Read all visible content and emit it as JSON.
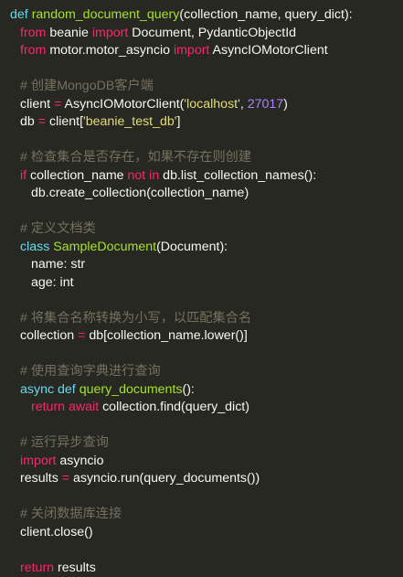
{
  "colors": {
    "background": "#272822",
    "text": "#f8f8f2",
    "keyword": "#f92672",
    "storage": "#66d9ef",
    "function": "#a6e22e",
    "string": "#e6db74",
    "number": "#ae81ff",
    "comment": "#75715e"
  },
  "code": {
    "lines": [
      {
        "indent": 0,
        "tokens": [
          {
            "t": "def",
            "k": "def"
          },
          {
            "t": " "
          },
          {
            "t": "random_document_query",
            "k": "fn"
          },
          {
            "t": "(collection_name, query_dict):"
          }
        ]
      },
      {
        "indent": 1,
        "tokens": [
          {
            "t": "from",
            "k": "kw"
          },
          {
            "t": " beanie "
          },
          {
            "t": "import",
            "k": "kw"
          },
          {
            "t": " Document, PydanticObjectId"
          }
        ]
      },
      {
        "indent": 1,
        "tokens": [
          {
            "t": "from",
            "k": "kw"
          },
          {
            "t": " motor.motor_asyncio "
          },
          {
            "t": "import",
            "k": "kw"
          },
          {
            "t": " AsyncIOMotorClient"
          }
        ]
      },
      {
        "indent": 0,
        "tokens": []
      },
      {
        "indent": 1,
        "tokens": [
          {
            "t": "# 创建MongoDB客户端",
            "k": "com"
          }
        ]
      },
      {
        "indent": 1,
        "tokens": [
          {
            "t": "client "
          },
          {
            "t": "=",
            "k": "op"
          },
          {
            "t": " AsyncIOMotorClient("
          },
          {
            "t": "'localhost'",
            "k": "str"
          },
          {
            "t": ", "
          },
          {
            "t": "27017",
            "k": "num"
          },
          {
            "t": ")"
          }
        ]
      },
      {
        "indent": 1,
        "tokens": [
          {
            "t": "db "
          },
          {
            "t": "=",
            "k": "op"
          },
          {
            "t": " client["
          },
          {
            "t": "'beanie_test_db'",
            "k": "str"
          },
          {
            "t": "]"
          }
        ]
      },
      {
        "indent": 0,
        "tokens": []
      },
      {
        "indent": 1,
        "tokens": [
          {
            "t": "# 检查集合是否存在，如果不存在则创建",
            "k": "com"
          }
        ]
      },
      {
        "indent": 1,
        "tokens": [
          {
            "t": "if",
            "k": "kw"
          },
          {
            "t": " collection_name "
          },
          {
            "t": "not in",
            "k": "kw"
          },
          {
            "t": " db.list_collection_names():"
          }
        ]
      },
      {
        "indent": 2,
        "tokens": [
          {
            "t": "db.create_collection(collection_name)"
          }
        ]
      },
      {
        "indent": 0,
        "tokens": []
      },
      {
        "indent": 1,
        "tokens": [
          {
            "t": "# 定义文档类",
            "k": "com"
          }
        ]
      },
      {
        "indent": 1,
        "tokens": [
          {
            "t": "class",
            "k": "def"
          },
          {
            "t": " "
          },
          {
            "t": "SampleDocument",
            "k": "fn"
          },
          {
            "t": "(Document):"
          }
        ]
      },
      {
        "indent": 2,
        "tokens": [
          {
            "t": "name: str"
          }
        ]
      },
      {
        "indent": 2,
        "tokens": [
          {
            "t": "age: int"
          }
        ]
      },
      {
        "indent": 0,
        "tokens": []
      },
      {
        "indent": 1,
        "tokens": [
          {
            "t": "# 将集合名称转换为小写，以匹配集合名",
            "k": "com"
          }
        ]
      },
      {
        "indent": 1,
        "tokens": [
          {
            "t": "collection "
          },
          {
            "t": "=",
            "k": "op"
          },
          {
            "t": " db[collection_name.lower()]"
          }
        ]
      },
      {
        "indent": 0,
        "tokens": []
      },
      {
        "indent": 1,
        "tokens": [
          {
            "t": "# 使用查询字典进行查询",
            "k": "com"
          }
        ]
      },
      {
        "indent": 1,
        "tokens": [
          {
            "t": "async",
            "k": "def"
          },
          {
            "t": " "
          },
          {
            "t": "def",
            "k": "def"
          },
          {
            "t": " "
          },
          {
            "t": "query_documents",
            "k": "fn"
          },
          {
            "t": "():"
          }
        ]
      },
      {
        "indent": 2,
        "tokens": [
          {
            "t": "return",
            "k": "kw"
          },
          {
            "t": " "
          },
          {
            "t": "await",
            "k": "kw"
          },
          {
            "t": " collection.find(query_dict)"
          }
        ]
      },
      {
        "indent": 0,
        "tokens": []
      },
      {
        "indent": 1,
        "tokens": [
          {
            "t": "# 运行异步查询",
            "k": "com"
          }
        ]
      },
      {
        "indent": 1,
        "tokens": [
          {
            "t": "import",
            "k": "kw"
          },
          {
            "t": " asyncio"
          }
        ]
      },
      {
        "indent": 1,
        "tokens": [
          {
            "t": "results "
          },
          {
            "t": "=",
            "k": "op"
          },
          {
            "t": " asyncio.run(query_documents())"
          }
        ]
      },
      {
        "indent": 0,
        "tokens": []
      },
      {
        "indent": 1,
        "tokens": [
          {
            "t": "# 关闭数据库连接",
            "k": "com"
          }
        ]
      },
      {
        "indent": 1,
        "tokens": [
          {
            "t": "client.close()"
          }
        ]
      },
      {
        "indent": 0,
        "tokens": []
      },
      {
        "indent": 1,
        "tokens": [
          {
            "t": "return",
            "k": "kw"
          },
          {
            "t": " results"
          }
        ]
      }
    ]
  }
}
